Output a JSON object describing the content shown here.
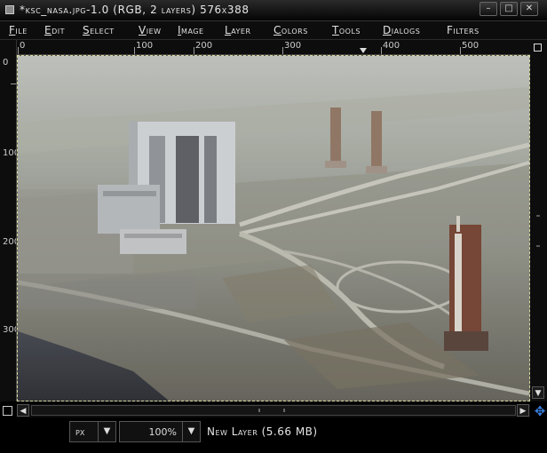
{
  "window": {
    "title": "*ksc_nasa.jpg-1.0 (RGB, 2 layers) 576x388",
    "minimize_glyph": "–",
    "maximize_glyph": "□",
    "close_glyph": "✕"
  },
  "menu": {
    "items": [
      {
        "acc": "F",
        "rest": "ile"
      },
      {
        "acc": "E",
        "rest": "dit"
      },
      {
        "acc": "S",
        "rest": "elect"
      },
      {
        "acc": "V",
        "rest": "iew"
      },
      {
        "acc": "I",
        "rest": "mage"
      },
      {
        "acc": "L",
        "rest": "ayer"
      },
      {
        "acc": "C",
        "rest": "olors"
      },
      {
        "acc": "T",
        "rest": "ools"
      },
      {
        "acc": "D",
        "rest": "ialogs"
      },
      {
        "acc": "",
        "rest": "Filters"
      }
    ]
  },
  "rulers": {
    "horizontal_labels": [
      "0",
      "100",
      "200",
      "300",
      "400",
      "500"
    ],
    "vertical_labels": [
      "0",
      "100",
      "200",
      "300"
    ]
  },
  "status": {
    "unit": "px",
    "zoom": "100%",
    "message": "New Layer (5.66 MB)"
  },
  "icons": {
    "nav": "navigate-icon",
    "quick_mask": "quick-mask-icon"
  }
}
